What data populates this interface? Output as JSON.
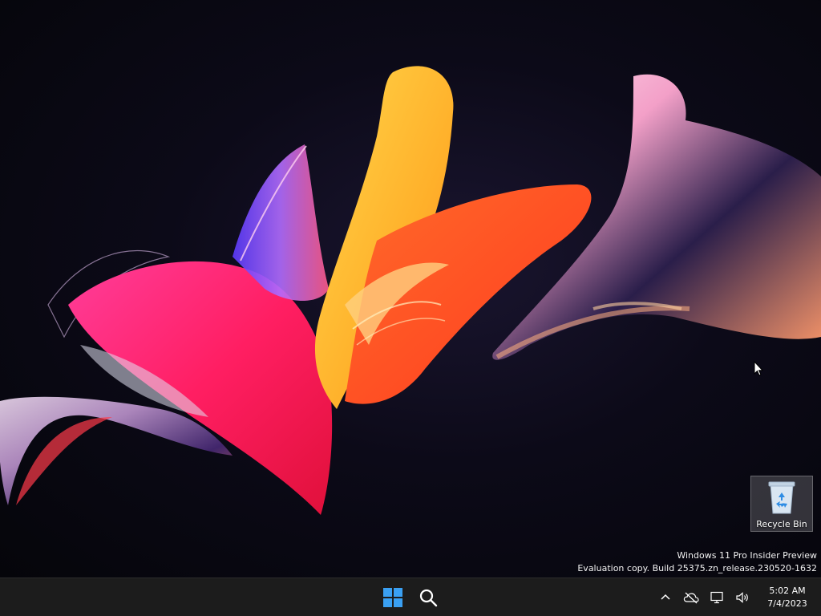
{
  "desktop": {
    "icons": [
      {
        "label": "Recycle Bin",
        "icon": "recycle-bin-icon"
      }
    ],
    "watermark": {
      "line1": "Windows 11 Pro Insider Preview",
      "line2": "Evaluation copy. Build 25375.zn_release.230520-1632"
    }
  },
  "taskbar": {
    "start_icon": "windows-logo-icon",
    "search_icon": "search-icon",
    "tray": {
      "icons": [
        "chevron-up-icon",
        "cloud-offline-icon",
        "network-icon",
        "volume-icon"
      ],
      "time": "5:02 AM",
      "date": "7/4/2023"
    }
  },
  "colors": {
    "taskbar_bg": "#1c1c1c",
    "windows_blue": "#3aa0f3"
  }
}
